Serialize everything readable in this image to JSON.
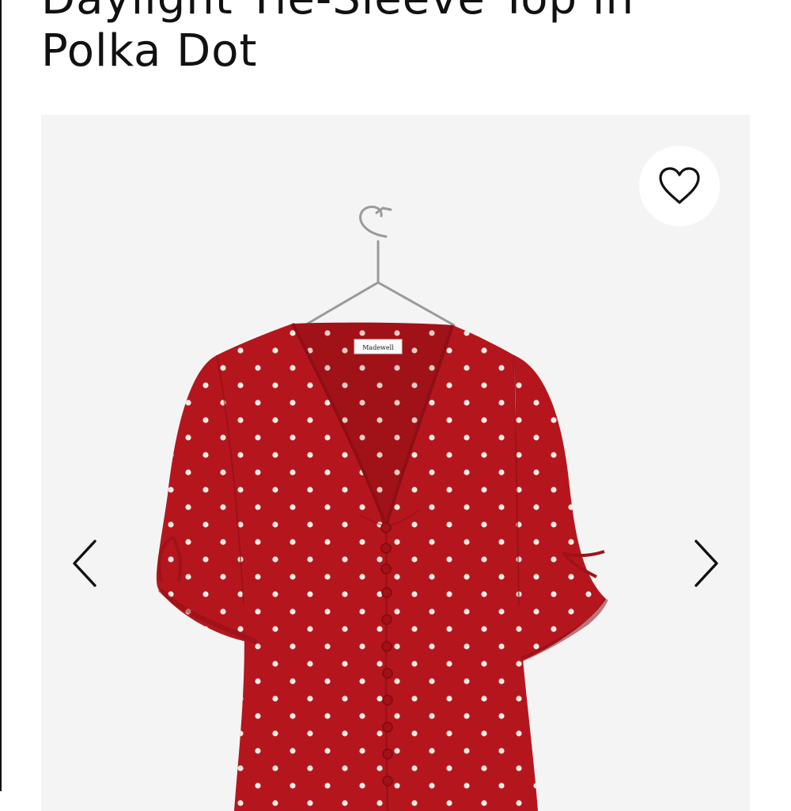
{
  "product": {
    "title_line_1": "Daylight Tie-Sleeve Top in",
    "title_line_2": "Polka Dot",
    "tag_text": "Madewell"
  },
  "gallery": {
    "favorite_icon": "heart-outline-icon",
    "prev_icon": "chevron-left-icon",
    "next_icon": "chevron-right-icon",
    "background_color": "#f4f4f4"
  },
  "colors": {
    "garment": "#b5161d",
    "garment_shadow": "#8e0f15",
    "dot": "#f4ece4",
    "icon": "#111111"
  }
}
